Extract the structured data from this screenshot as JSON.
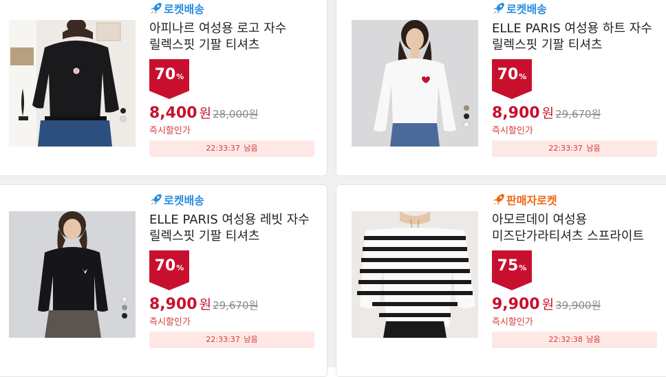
{
  "colors": {
    "accent": "#c8102e",
    "rocket_blue": "#2a8be0",
    "rocket_orange": "#f1620f",
    "timer_bg": "#fde8e6"
  },
  "products": [
    {
      "shipping": "로켓배송",
      "shipping_icon": "rocket-icon",
      "title": "아피나르 여성용 로고 자수 릴렉스핏 기팔 티셔츠",
      "discount": "70",
      "percent_sign": "%",
      "price": "8,400",
      "currency": "원",
      "original_price": "28,000원",
      "instant_label": "즉시할인가",
      "timer": "22:33:37",
      "remaining": "남음"
    },
    {
      "shipping": "로켓배송",
      "shipping_icon": "rocket-icon",
      "title": "ELLE PARIS 여성용 하트 자수 릴렉스핏 기팔 티셔츠",
      "discount": "70",
      "percent_sign": "%",
      "price": "8,900",
      "currency": "원",
      "original_price": "29,670원",
      "instant_label": "즉시할인가",
      "timer": "22:33:37",
      "remaining": "남음"
    },
    {
      "shipping": "로켓배송",
      "shipping_icon": "rocket-icon",
      "title": "ELLE PARIS 여성용 레빗 자수 릴렉스핏 기팔 티셔츠",
      "discount": "70",
      "percent_sign": "%",
      "price": "8,900",
      "currency": "원",
      "original_price": "29,670원",
      "instant_label": "즉시할인가",
      "timer": "22:33:37",
      "remaining": "남음"
    },
    {
      "shipping": "판매자로켓",
      "shipping_icon": "rocket-icon",
      "title": "아모르데이 여성용 미즈단가라티셔츠 스프라이트 루즈...",
      "discount": "75",
      "percent_sign": "%",
      "price": "9,900",
      "currency": "원",
      "original_price": "39,900원",
      "instant_label": "즉시할인가",
      "timer": "22:32:38",
      "remaining": "남음"
    }
  ]
}
